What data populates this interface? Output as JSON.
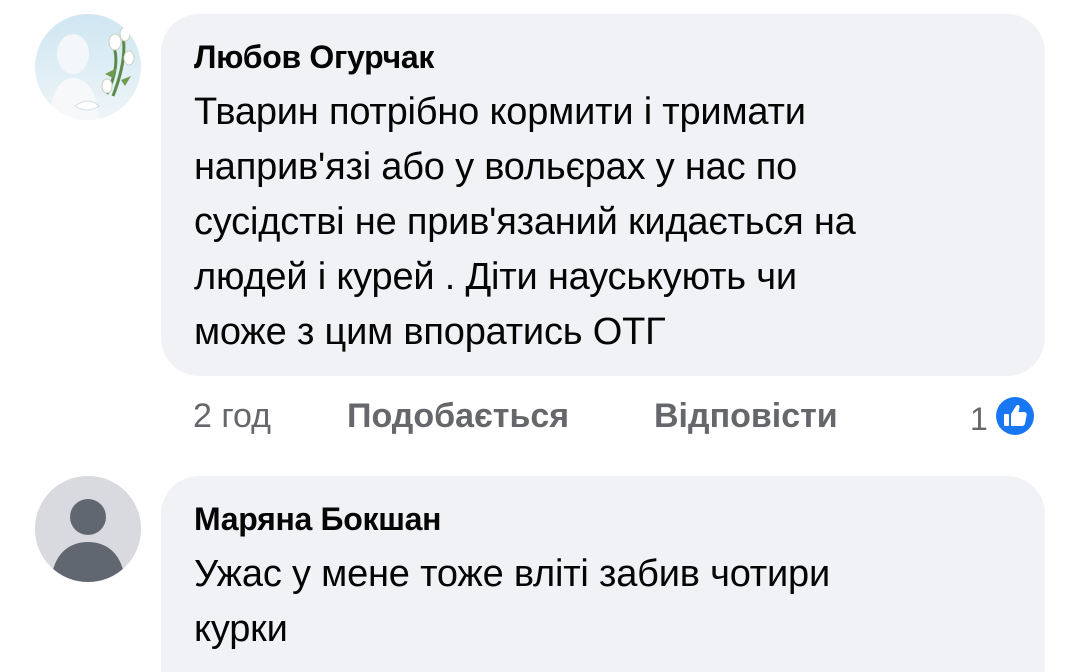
{
  "comments": [
    {
      "author": "Любов Огурчак",
      "text": "Тварин потрібно кормити і тримати\nнаприв'язі або у вольєрах  у нас по\nсусідстві не прив'язаний кидається на\nлюдей і курей . Діти науськують  чи\nможе з цим впоратись ОТГ",
      "time": "2 год",
      "like_label": "Подобається",
      "reply_label": "Відповісти",
      "reaction_count": "1",
      "reaction_icon": "like-icon",
      "avatar_icon": "profile-photo-flowers"
    },
    {
      "author": "Маряна Бокшан",
      "text": "Ужас у мене тоже вліті забив чотири\nкурки",
      "avatar_icon": "default-avatar-icon"
    }
  ],
  "colors": {
    "bubble": "#f0f2f5",
    "meta_text": "#65676b",
    "like_blue": "#1877f2",
    "default_avatar_bg": "#bcc0c4"
  }
}
